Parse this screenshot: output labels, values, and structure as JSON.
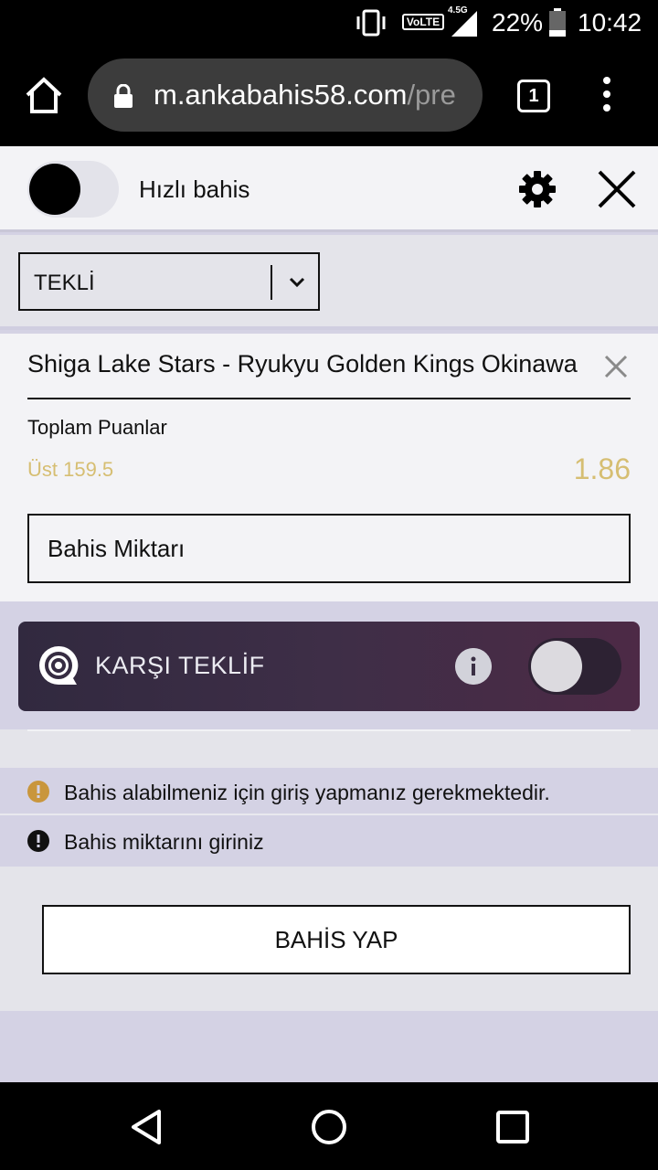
{
  "status_bar": {
    "network_label": "VoLTE",
    "network_type": "4.5G",
    "battery_percent": "22%",
    "time": "10:42"
  },
  "browser": {
    "url_domain": "m.ankabahis58.com",
    "url_path": "/pre",
    "tab_count": "1"
  },
  "header": {
    "quick_bet_label": "Hızlı bahis",
    "quick_bet_enabled": false
  },
  "bet_type": {
    "selected": "TEKLİ"
  },
  "bet": {
    "match": "Shiga Lake Stars - Ryukyu Golden Kings Okinawa",
    "market": "Toplam Puanlar",
    "selection": "Üst 159.5",
    "odds": "1.86",
    "stake_placeholder": "Bahis Miktarı"
  },
  "counter_offer": {
    "label": "KARŞI TEKLİF",
    "enabled": false
  },
  "messages": [
    {
      "text": "Bahis alabilmeniz için giriş yapmanız gerekmektedir.",
      "color": "#c9963c"
    },
    {
      "text": "Bahis miktarını giriniz",
      "color": "#111111"
    }
  ],
  "submit": {
    "label": "BAHİS YAP"
  },
  "colors": {
    "accent_gold": "#d6be72",
    "panel_purple": "#d4d2e4",
    "counter_offer_gradient_start": "#31293f",
    "counter_offer_gradient_end": "#4d2a46"
  }
}
